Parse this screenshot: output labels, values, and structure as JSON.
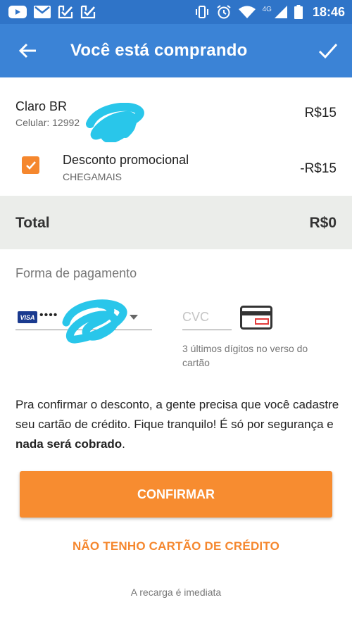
{
  "status_bar": {
    "time": "18:46",
    "network": "4G",
    "icons": [
      "youtube-icon",
      "gmail-icon",
      "check-badge-icon",
      "check-badge-icon",
      "vibrate-icon",
      "alarm-icon",
      "wifi-icon",
      "signal-icon",
      "battery-icon"
    ]
  },
  "app_bar": {
    "title": "Você está comprando",
    "back_icon": "arrow-back-icon",
    "confirm_icon": "check-icon"
  },
  "product": {
    "name": "Claro BR",
    "phone": "Celular: 12992",
    "price": "R$15"
  },
  "discount": {
    "checked": true,
    "label": "Desconto promocional",
    "code": "CHEGAMAIS",
    "amount": "-R$15"
  },
  "total": {
    "label": "Total",
    "value": "R$0"
  },
  "payment": {
    "title": "Forma de pagamento",
    "card_brand": "VISA",
    "card_masked": "••••",
    "cvc_placeholder": "CVC",
    "cvc_value": "",
    "cvc_help": "3 últimos dígitos no verso do cartão"
  },
  "info": {
    "text_before": "Pra confirmar o desconto, a gente precisa que você cadastre seu cartão de crédito. Fique tranquilo! É só por segurança e ",
    "text_bold": "nada será cobrado",
    "text_after": "."
  },
  "actions": {
    "confirm_label": "CONFIRMAR",
    "no_card_label": "NÃO TENHO CARTÃO DE CRÉDITO"
  },
  "footer": {
    "note": "A recarga é imediata"
  },
  "colors": {
    "status_bar": "#2f74c8",
    "app_bar": "#3b83d6",
    "accent": "#f78c30",
    "total_bg": "#ebedea"
  }
}
